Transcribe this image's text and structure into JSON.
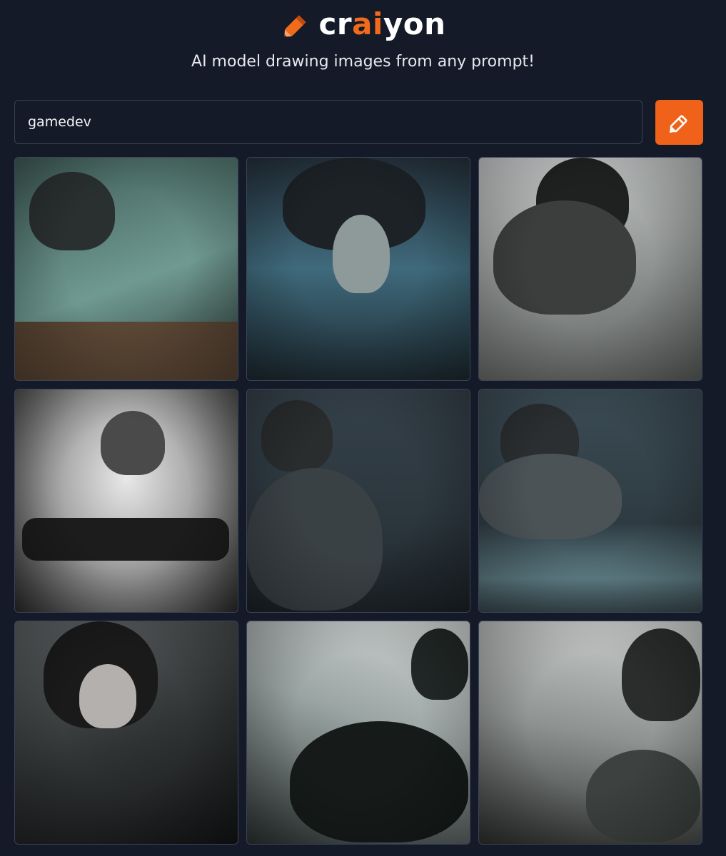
{
  "header": {
    "logo_text_start": "cr",
    "logo_text_accent": "ai",
    "logo_text_end": "yon",
    "tagline": "AI model drawing images from any prompt!"
  },
  "search": {
    "value": "gamedev"
  },
  "colors": {
    "accent": "#f26b1d",
    "background": "#141a28",
    "button": "#f0621a"
  },
  "icons": {
    "logo": "crayon-pencil-icon",
    "draw_button": "pencil-icon"
  },
  "results": {
    "count": 9
  }
}
